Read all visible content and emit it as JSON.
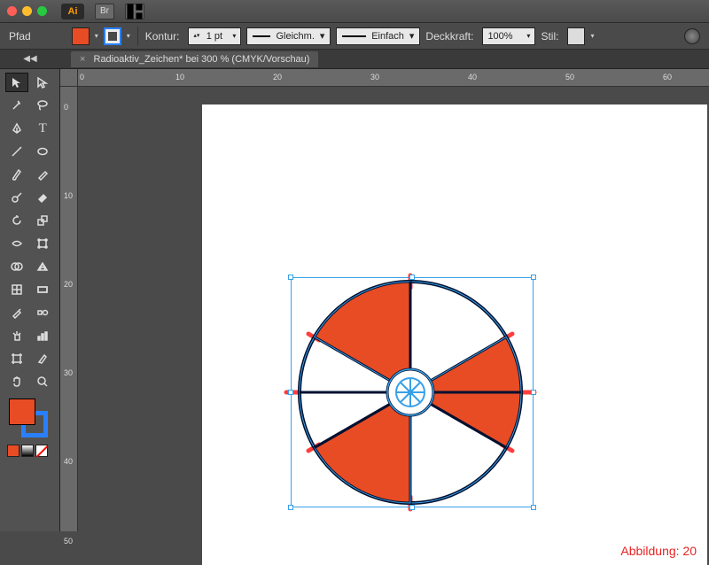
{
  "titlebar": {
    "app": "Ai",
    "bridge": "Br"
  },
  "control": {
    "path_label": "Pfad",
    "stroke_label": "Kontur:",
    "stroke_weight": "1 pt",
    "profile_label": "Gleichm.",
    "brush_label": "Einfach",
    "opacity_label": "Deckkraft:",
    "opacity_value": "100%",
    "style_label": "Stil:"
  },
  "tab": {
    "title": "Radioaktiv_Zeichen* bei 300 % (CMYK/Vorschau)"
  },
  "ruler_h": [
    "0",
    "10",
    "20",
    "30",
    "40",
    "50",
    "60"
  ],
  "ruler_v": [
    "0",
    "10",
    "20",
    "30",
    "40",
    "50"
  ],
  "artwork": {
    "fill_color": "#e84c24",
    "stroke_color": "#001030",
    "selection_color": "#39a0e8"
  },
  "caption": "Abbildung: 20"
}
